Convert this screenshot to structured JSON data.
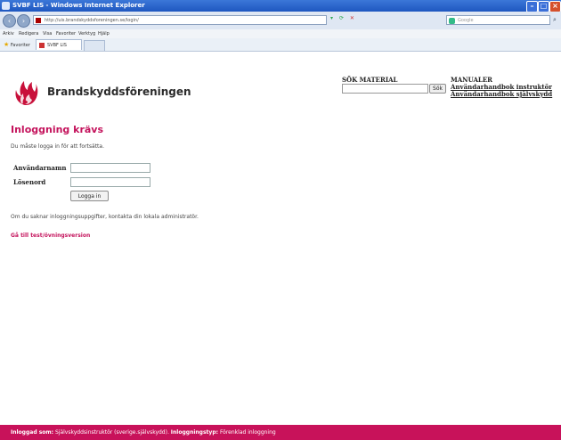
{
  "window": {
    "title": "SVBF LIS - Windows Internet Explorer",
    "address": "http://uis.brandskyddsforeningen.se/login/",
    "search_placeholder": "Google"
  },
  "menu": [
    "Arkiv",
    "Redigera",
    "Visa",
    "Favoriter",
    "Verktyg",
    "Hjälp"
  ],
  "favorites_bar": {
    "favorites_label": "Favoriter",
    "tab_label": "SVBF LIS"
  },
  "brand": {
    "name": "Brandskyddsföreningen"
  },
  "search": {
    "label": "SÖK MATERIAL",
    "input_value": "",
    "button_label": "Sök"
  },
  "manuals": {
    "title": "MANUALER",
    "links": [
      "Användarhandbok instruktör",
      "Användarhandbok självskydd"
    ]
  },
  "login": {
    "heading": "Inloggning krävs",
    "intro": "Du måste logga in för att fortsätta.",
    "username_label": "Användarnamn",
    "password_label": "Lösenord",
    "button_label": "Logga in",
    "contact_text": "Om du saknar inloggningsuppgifter, kontakta din lokala administratör.",
    "test_link": "Gå till test/övningsversion"
  },
  "footer": {
    "logged_in_label": "Inloggad som:",
    "logged_in_value": "Självskyddsinstruktör (sverige.självskydd).",
    "login_type_label": "Inloggningstyp:",
    "login_type_value": "Förenklad inloggning"
  },
  "colors": {
    "accent": "#c4135c",
    "footer_bg": "#c8125a",
    "titlebar": "#2a62c9"
  }
}
